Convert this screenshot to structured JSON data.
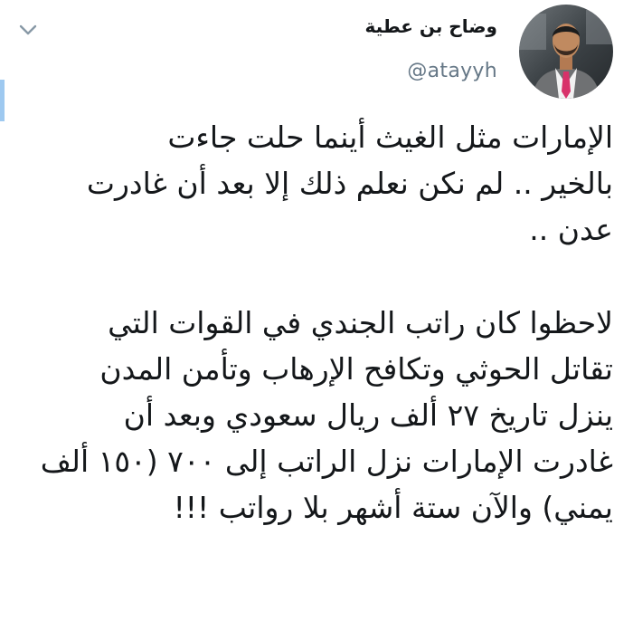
{
  "tweet": {
    "display_name": "وضاح بن عطية",
    "handle": "@atayyh",
    "paragraph1": [
      "الإمارات مثل الغيث أينما حلت جاءت",
      "بالخير .. لم نكن نعلم ذلك إلا بعد أن غادرت",
      "عدن .."
    ],
    "paragraph2": [
      "لاحظوا كان راتب الجندي في القوات التي",
      "تقاتل الحوثي وتكافح الإرهاب وتأمن المدن",
      "ينزل تاريخ ٢٧ ألف ريال سعودي وبعد أن",
      "غادرت الإمارات نزل الراتب إلى ٧٠٠ (١٥٠ ألف",
      "يمني) والآن ستة أشهر بلا رواتب !!!"
    ]
  },
  "icons": {
    "menu": "chevron-down-icon",
    "avatar": "user-avatar"
  },
  "colors": {
    "text": "#14171a",
    "muted": "#657786",
    "accent": "#9ec9f0",
    "chevron": "#8899a6"
  }
}
